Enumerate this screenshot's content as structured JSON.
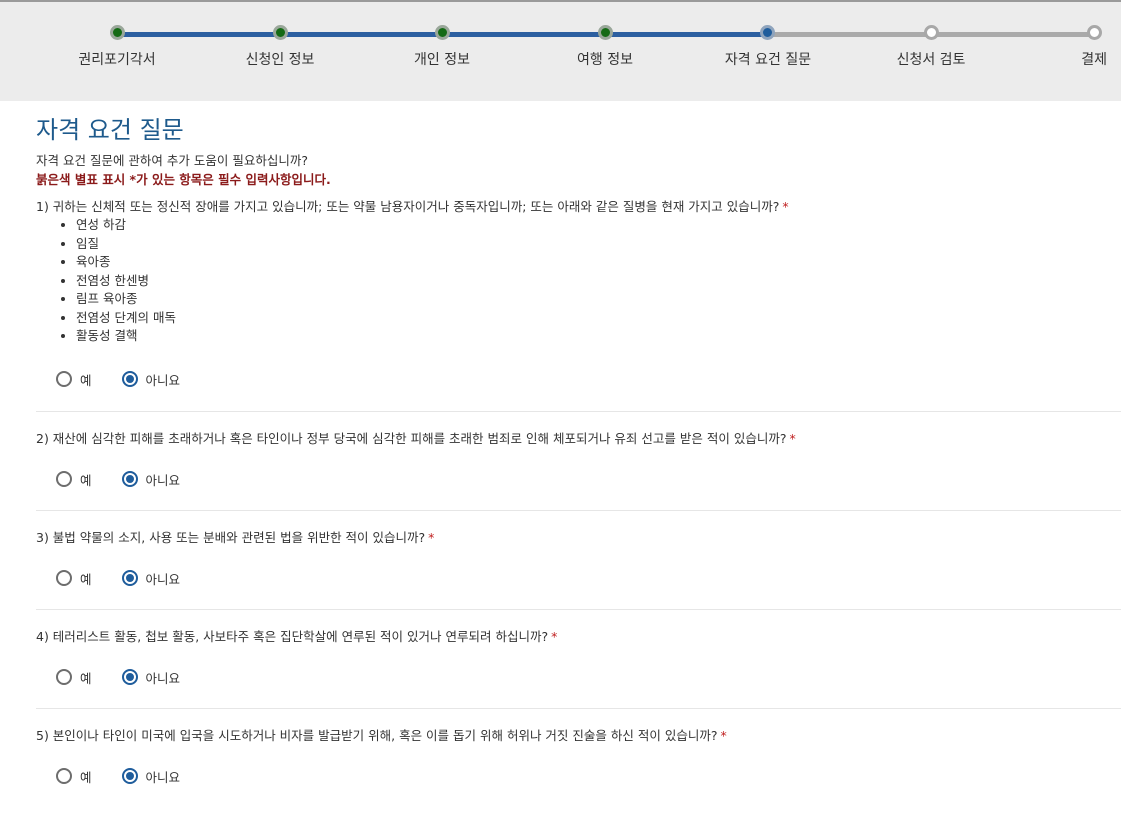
{
  "stepper": {
    "steps": [
      {
        "label": "권리포기각서",
        "state": "done"
      },
      {
        "label": "신청인 정보",
        "state": "done"
      },
      {
        "label": "개인 정보",
        "state": "done"
      },
      {
        "label": "여행 정보",
        "state": "done"
      },
      {
        "label": "자격 요건 질문",
        "state": "current"
      },
      {
        "label": "신청서 검토",
        "state": "todo"
      },
      {
        "label": "결제",
        "state": "todo"
      }
    ],
    "colors": {
      "done": "#146a14",
      "current": "#1f5d9c",
      "track_done": "#2c5fa0",
      "track_todo": "#aaaaaa"
    }
  },
  "page": {
    "title": "자격 요건 질문",
    "help_text": "자격 요건 질문에 관하여 추가 도움이 필요하십니까?",
    "required_note": "붉은색 별표 표시 *가 있는 항목은 필수 입력사항입니다."
  },
  "required_marker": "*",
  "questions": [
    {
      "text": "1) 귀하는 신체적 또는 정신적 장애를 가지고 있습니까; 또는 약물 남용자이거나 중독자입니까; 또는 아래와 같은 질병을 현재 가지고 있습니까?",
      "list": [
        "연성 하감",
        "임질",
        "육아종",
        "전염성 한센병",
        "림프 육아종",
        "전염성 단계의 매독",
        "활동성 결핵"
      ],
      "options": {
        "yes": "예",
        "no": "아니요"
      },
      "selected": "no"
    },
    {
      "text": "2) 재산에 심각한 피해를 초래하거나 혹은 타인이나 정부 당국에 심각한 피해를 초래한 범죄로 인해 체포되거나 유죄 선고를 받은 적이 있습니까?",
      "options": {
        "yes": "예",
        "no": "아니요"
      },
      "selected": "no"
    },
    {
      "text": "3) 불법 약물의 소지, 사용 또는 분배와 관련된 법을 위반한 적이 있습니까?",
      "options": {
        "yes": "예",
        "no": "아니요"
      },
      "selected": "no"
    },
    {
      "text": "4) 테러리스트 활동, 첩보 활동, 사보타주 혹은 집단학살에 연루된 적이 있거나 연루되려 하십니까?",
      "options": {
        "yes": "예",
        "no": "아니요"
      },
      "selected": "no"
    },
    {
      "text": "5) 본인이나 타인이 미국에 입국을 시도하거나 비자를 발급받기 위해, 혹은 이를 돕기 위해 허위나 거짓 진술을 하신 적이 있습니까?",
      "options": {
        "yes": "예",
        "no": "아니요"
      },
      "selected": "no"
    }
  ]
}
